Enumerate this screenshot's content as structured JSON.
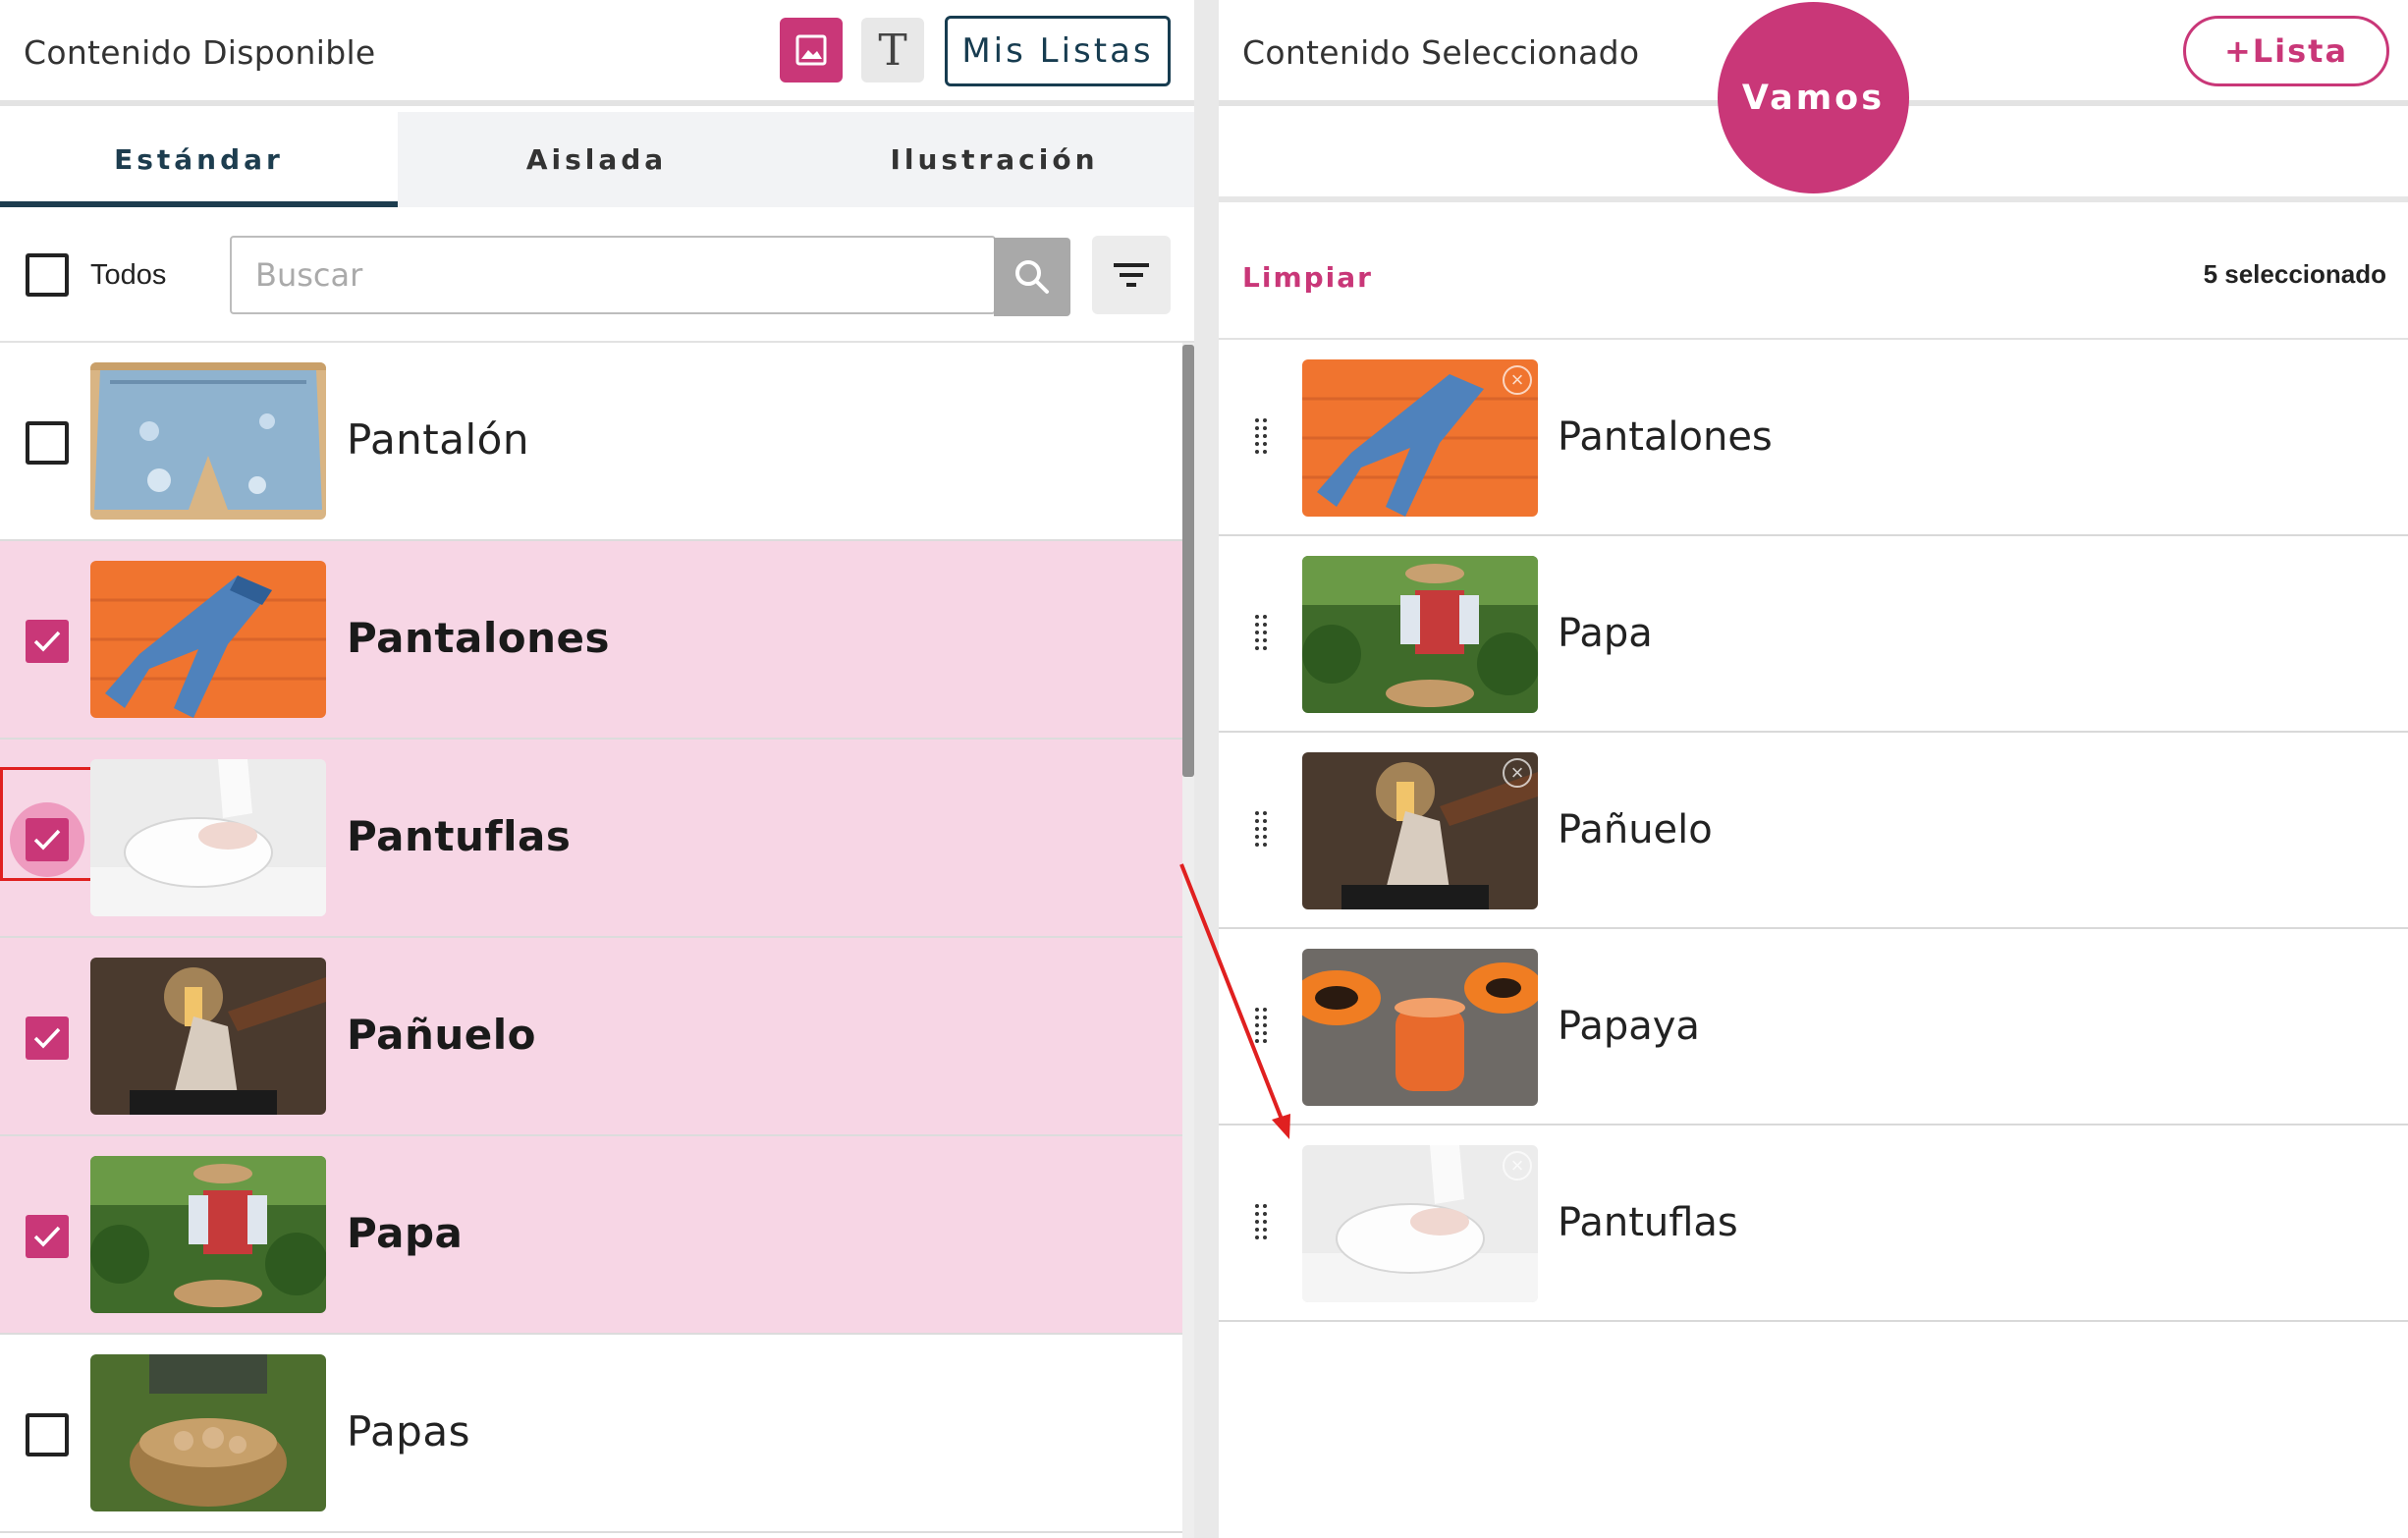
{
  "left_panel": {
    "title": "Contenido Disponible",
    "mis_listas_label": "Mis Listas",
    "tabs": [
      {
        "label": "Estándar",
        "active": true
      },
      {
        "label": "Aislada",
        "active": false
      },
      {
        "label": "Ilustración",
        "active": false
      }
    ],
    "todos_label": "Todos",
    "search_placeholder": "Buscar",
    "items": [
      {
        "label": "Pantalón",
        "checked": false,
        "image": "denim-shorts-photo"
      },
      {
        "label": "Pantalones",
        "checked": true,
        "image": "jeans-on-orange-wood-photo"
      },
      {
        "label": "Pantuflas",
        "checked": true,
        "image": "white-slippers-photo"
      },
      {
        "label": "Pañuelo",
        "checked": true,
        "image": "tissue-box-photo"
      },
      {
        "label": "Papa",
        "checked": true,
        "image": "farmer-with-potatoes-photo"
      },
      {
        "label": "Papas",
        "checked": false,
        "image": "basket-of-potatoes-photo"
      }
    ]
  },
  "right_panel": {
    "title": "Contenido Seleccionado",
    "add_list_label": "+Lista",
    "vamos_label": "Vamos",
    "limpiar_label": "Limpiar",
    "selected_count": "5 seleccionado",
    "items": [
      {
        "label": "Pantalones",
        "image": "jeans-on-orange-wood-photo"
      },
      {
        "label": "Papa",
        "image": "farmer-with-potatoes-photo"
      },
      {
        "label": "Pañuelo",
        "image": "tissue-box-photo"
      },
      {
        "label": "Papaya",
        "image": "papaya-smoothie-photo"
      },
      {
        "label": "Pantuflas",
        "image": "white-slippers-photo"
      }
    ]
  },
  "colors": {
    "accent": "#c93778",
    "selected_row": "#f7d6e5",
    "navy": "#1d3d4f",
    "annotation_red": "#e02020"
  }
}
